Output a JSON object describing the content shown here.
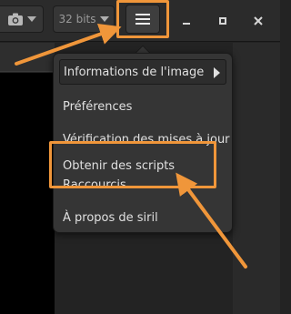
{
  "header": {
    "camera_icon": "camera-icon",
    "bit_depth": "32 bits",
    "menu_icon": "hamburger-menu-icon",
    "window_controls": [
      "minimize-icon",
      "maximize-icon",
      "close-icon"
    ]
  },
  "menu": {
    "items": [
      {
        "label": "Informations de l'image",
        "has_submenu": true
      },
      {
        "label": "Préférences"
      },
      {
        "label": "Vérification des mises à jour"
      },
      {
        "label": "Obtenir des scripts"
      },
      {
        "label": "Raccourcis"
      },
      {
        "label": "À propos de siril"
      }
    ]
  },
  "annotations": {
    "highlight_color": "#f0963a",
    "highlighted": [
      "hamburger-menu-button",
      "Obtenir des scripts"
    ]
  }
}
